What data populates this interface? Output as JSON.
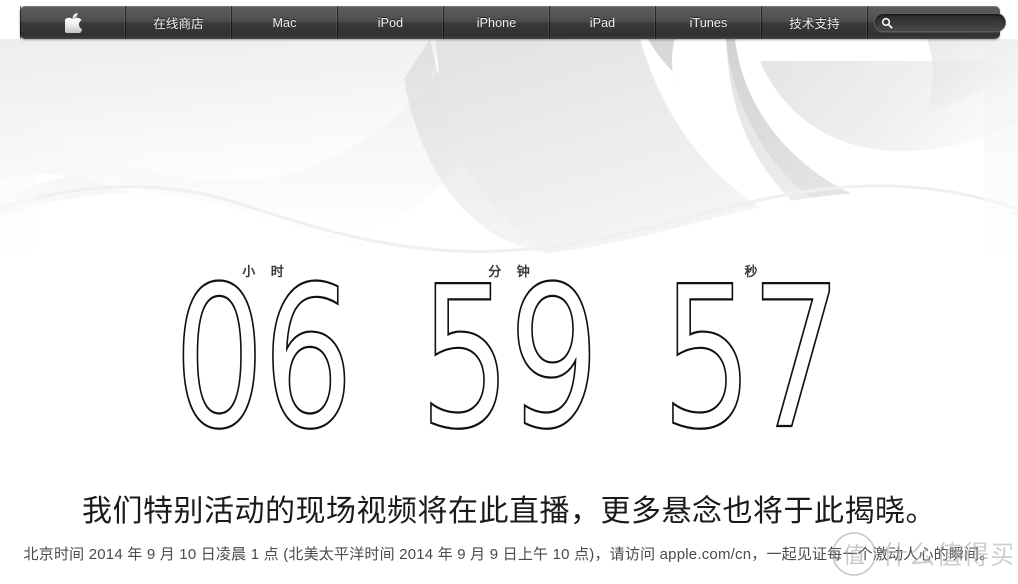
{
  "globalnav": {
    "items": [
      {
        "key": "apple",
        "label": "",
        "icon": "apple-logo-icon"
      },
      {
        "key": "store",
        "label": "在线商店"
      },
      {
        "key": "mac",
        "label": "Mac"
      },
      {
        "key": "ipod",
        "label": "iPod"
      },
      {
        "key": "iphone",
        "label": "iPhone"
      },
      {
        "key": "ipad",
        "label": "iPad"
      },
      {
        "key": "itunes",
        "label": "iTunes"
      },
      {
        "key": "support",
        "label": "技术支持"
      }
    ],
    "search": {
      "placeholder": "",
      "value": "",
      "icon": "search-icon"
    },
    "colors": {
      "bar_top": "#6e6e6e",
      "bar_bottom": "#313131",
      "text": "#f2f2f2"
    }
  },
  "hero": {
    "alt": "apple-logo-artwork",
    "colors": {
      "background": "#ffffff",
      "shade_light": "#f4f4f4",
      "shade_mid": "#e4e4e4",
      "shade_dark": "#d0d0d0"
    }
  },
  "countdown": {
    "units": [
      {
        "key": "hours",
        "label": "小 时",
        "value": "06"
      },
      {
        "key": "minutes",
        "label": "分 钟",
        "value": "59"
      },
      {
        "key": "seconds",
        "label": "秒",
        "value": "57"
      }
    ],
    "value_color": "#111111",
    "label_color": "#3a3a3a"
  },
  "copy": {
    "headline": "我们特别活动的现场视频将在此直播，更多悬念也将于此揭晓。",
    "subline": "北京时间 2014 年 9 月 10 日凌晨 1 点 (北美太平洋时间 2014 年 9 月 9 日上午 10 点)，请访问 apple.com/cn，一起见证每一个激动人心的瞬间。"
  },
  "watermark": {
    "text": "什么值得买",
    "mark": "值"
  }
}
